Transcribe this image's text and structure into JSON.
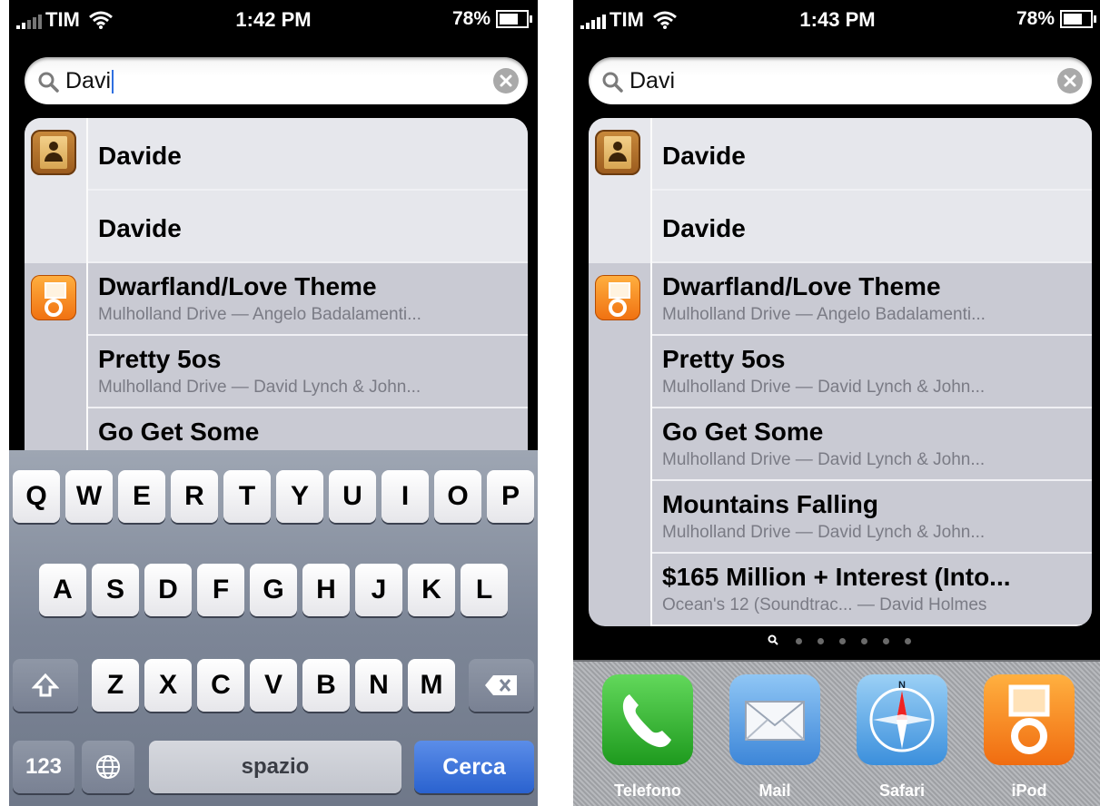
{
  "left": {
    "status": {
      "carrier": "TIM",
      "time": "1:42 PM",
      "battery": "78%",
      "battery_level": 0.78
    },
    "search": {
      "query": "Davi"
    },
    "contacts_results": [
      {
        "title": "Davide"
      },
      {
        "title": "Davide"
      }
    ],
    "music_results": [
      {
        "title": "Dwarfland/Love Theme",
        "subtitle": "Mulholland Drive — Angelo Badalamenti..."
      },
      {
        "title": "Pretty 5os",
        "subtitle": "Mulholland Drive — David Lynch & John..."
      },
      {
        "title": "Go Get Some",
        "subtitle": ""
      }
    ],
    "keyboard": {
      "row1": [
        "Q",
        "W",
        "E",
        "R",
        "T",
        "Y",
        "U",
        "I",
        "O",
        "P"
      ],
      "row2": [
        "A",
        "S",
        "D",
        "F",
        "G",
        "H",
        "J",
        "K",
        "L"
      ],
      "row3": [
        "Z",
        "X",
        "C",
        "V",
        "B",
        "N",
        "M"
      ],
      "numbers_label": "123",
      "space_label": "spazio",
      "search_label": "Cerca"
    }
  },
  "right": {
    "status": {
      "carrier": "TIM",
      "time": "1:43 PM",
      "battery": "78%",
      "battery_level": 0.78
    },
    "search": {
      "query": "Davi"
    },
    "contacts_results": [
      {
        "title": "Davide"
      },
      {
        "title": "Davide"
      }
    ],
    "music_results": [
      {
        "title": "Dwarfland/Love Theme",
        "subtitle": "Mulholland Drive — Angelo Badalamenti..."
      },
      {
        "title": "Pretty 5os",
        "subtitle": "Mulholland Drive — David Lynch & John..."
      },
      {
        "title": "Go Get Some",
        "subtitle": "Mulholland Drive — David Lynch & John..."
      },
      {
        "title": "Mountains Falling",
        "subtitle": "Mulholland Drive — David Lynch & John..."
      },
      {
        "title": "$165 Million + Interest (Into...",
        "subtitle": "Ocean's 12 (Soundtrac... — David Holmes"
      }
    ],
    "page_dots": {
      "count": 6,
      "active": "search"
    },
    "dock": [
      {
        "label": "Telefono",
        "icon": "phone-icon"
      },
      {
        "label": "Mail",
        "icon": "mail-icon"
      },
      {
        "label": "Safari",
        "icon": "safari-icon"
      },
      {
        "label": "iPod",
        "icon": "ipod-icon"
      }
    ]
  },
  "colors": {
    "search_key": "#2a62cf",
    "results_bg": "#c9cad3",
    "contacts_bg": "#e6e7ec"
  }
}
